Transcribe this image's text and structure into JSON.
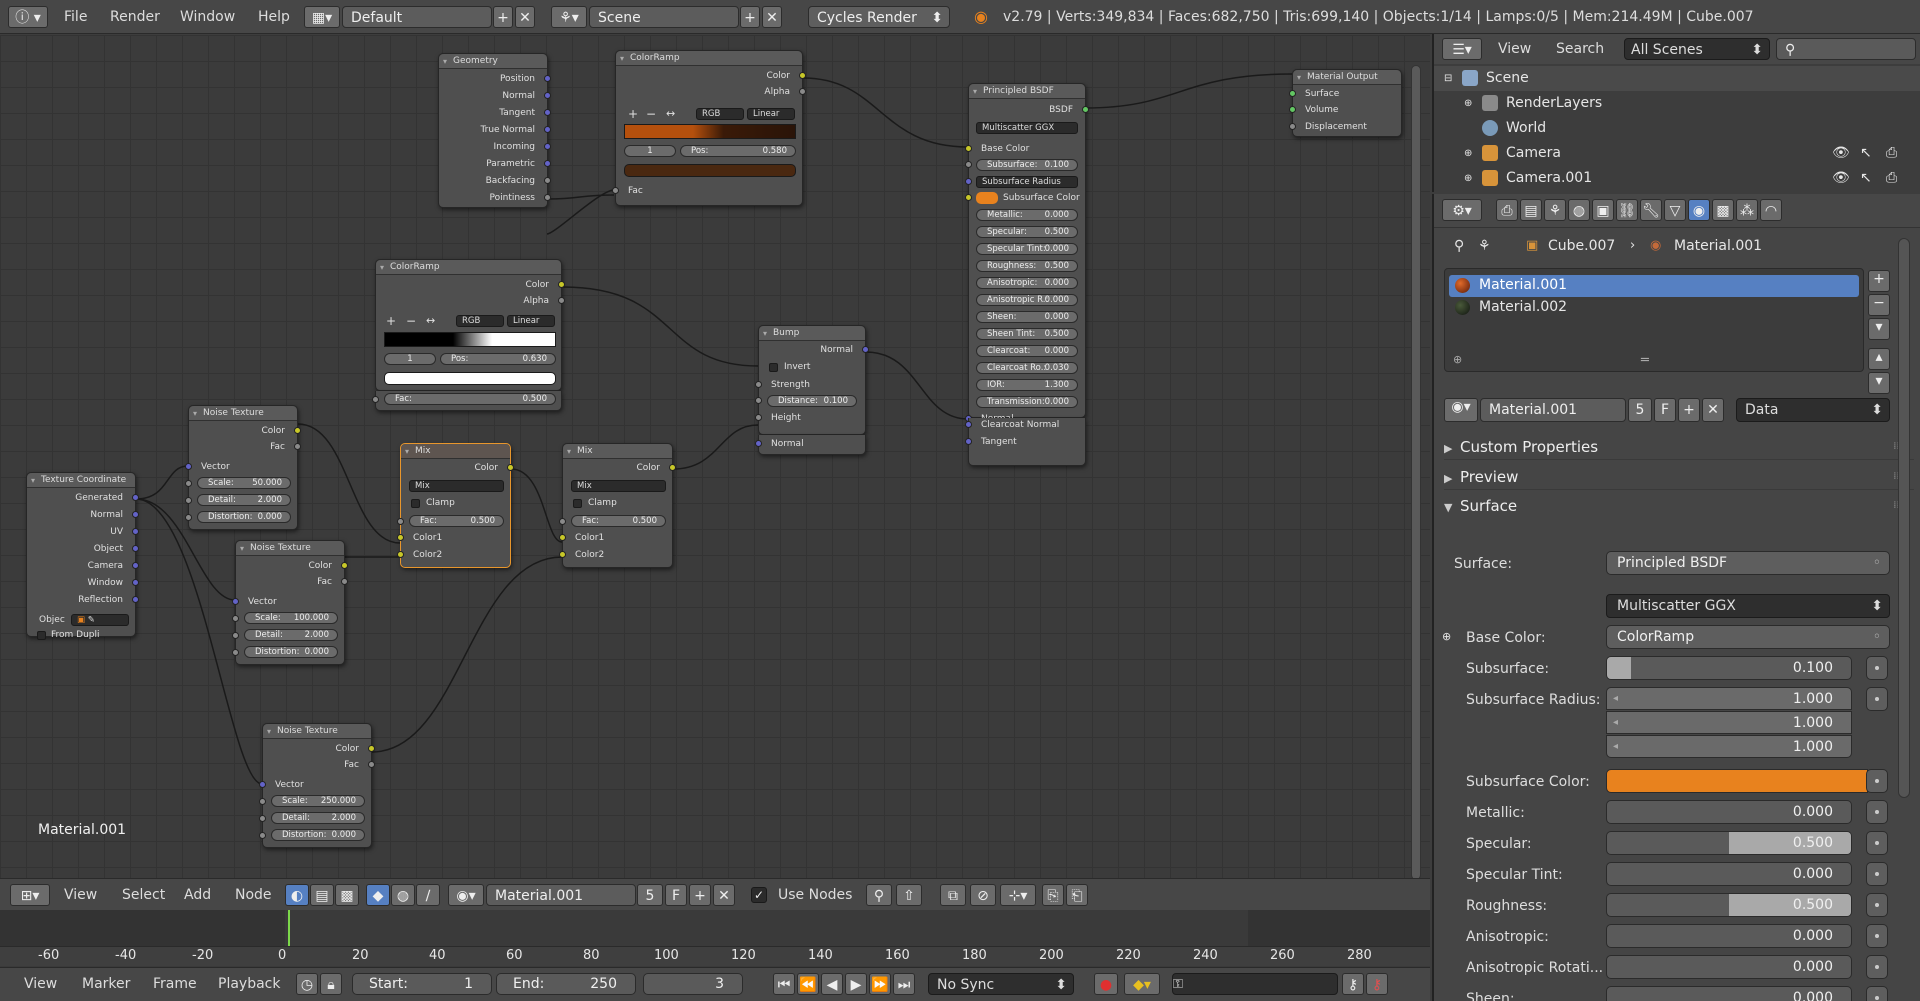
{
  "topbar": {
    "menus": [
      "File",
      "Render",
      "Window",
      "Help"
    ],
    "layout": "Default",
    "scene": "Scene",
    "engine": "Cycles Render",
    "stats": "v2.79 | Verts:349,834 | Faces:682,750 | Tris:699,140 | Objects:1/14 | Lamps:0/5 | Mem:214.49M | Cube.007"
  },
  "editor": {
    "material_label": "Material.001"
  },
  "nodes": {
    "geometry": {
      "title": "Geometry",
      "outputs": [
        "Position",
        "Normal",
        "Tangent",
        "True Normal",
        "Incoming",
        "Parametric",
        "Backfacing",
        "Pointiness"
      ]
    },
    "colorramp1": {
      "title": "ColorRamp",
      "out_color": "Color",
      "out_alpha": "Alpha",
      "mode": "RGB",
      "interp": "Linear",
      "index": "1",
      "pos_label": "Pos:",
      "pos_val": "0.580",
      "fac": "Fac"
    },
    "colorramp2": {
      "title": "ColorRamp",
      "out_color": "Color",
      "out_alpha": "Alpha",
      "mode": "RGB",
      "interp": "Linear",
      "index": "1",
      "pos_label": "Pos:",
      "pos_val": "0.630",
      "fac_label": "Fac:",
      "fac_val": "0.500"
    },
    "principled": {
      "title": "Principled BSDF",
      "out": "BSDF",
      "dist": "Multiscatter GGX",
      "base_color": "Base Color",
      "subsurface_label": "Subsurface:",
      "subsurface_val": "0.100",
      "ss_radius": "Subsurface Radius",
      "ss_color": "Subsurface Color",
      "params": [
        [
          "Metallic:",
          "0.000"
        ],
        [
          "Specular:",
          "0.500"
        ],
        [
          "Specular Tint:",
          "0.000"
        ],
        [
          "Roughness:",
          "0.500"
        ],
        [
          "Anisotropic:",
          "0.000"
        ],
        [
          "Anisotropic R.:",
          "0.000"
        ],
        [
          "Sheen:",
          "0.000"
        ],
        [
          "Sheen Tint:",
          "0.500"
        ],
        [
          "Clearcoat:",
          "0.000"
        ],
        [
          "Clearcoat Ro.:",
          "0.030"
        ],
        [
          "IOR:",
          "1.300"
        ],
        [
          "Transmission:",
          "0.000"
        ]
      ],
      "in_normal": "Normal",
      "in_cc_normal": "Clearcoat Normal",
      "in_tangent": "Tangent"
    },
    "output": {
      "title": "Material Output",
      "inputs": [
        "Surface",
        "Volume",
        "Displacement"
      ]
    },
    "bump": {
      "title": "Bump",
      "out": "Normal",
      "invert": "Invert",
      "strength": "Strength",
      "dist_label": "Distance:",
      "dist_val": "0.100",
      "height": "Height",
      "normal": "Normal"
    },
    "noise1": {
      "title": "Noise Texture",
      "out_color": "Color",
      "out_fac": "Fac",
      "vector": "Vector",
      "scale_l": "Scale:",
      "scale_v": "50.000",
      "detail_l": "Detail:",
      "detail_v": "2.000",
      "dist_l": "Distortion:",
      "dist_v": "0.000"
    },
    "noise2": {
      "title": "Noise Texture",
      "out_color": "Color",
      "out_fac": "Fac",
      "vector": "Vector",
      "scale_l": "Scale:",
      "scale_v": "100.000",
      "detail_l": "Detail:",
      "detail_v": "2.000",
      "dist_l": "Distortion:",
      "dist_v": "0.000"
    },
    "noise3": {
      "title": "Noise Texture",
      "out_color": "Color",
      "out_fac": "Fac",
      "vector": "Vector",
      "scale_l": "Scale:",
      "scale_v": "250.000",
      "detail_l": "Detail:",
      "detail_v": "2.000",
      "dist_l": "Distortion:",
      "dist_v": "0.000"
    },
    "texcoord": {
      "title": "Texture Coordinate",
      "outputs": [
        "Generated",
        "Normal",
        "UV",
        "Object",
        "Camera",
        "Window",
        "Reflection"
      ],
      "object": "Objec",
      "from_dupli": "From Dupli"
    },
    "mix1": {
      "title": "Mix",
      "out": "Color",
      "blend": "Mix",
      "clamp": "Clamp",
      "fac_l": "Fac:",
      "fac_v": "0.500",
      "c1": "Color1",
      "c2": "Color2"
    },
    "mix2": {
      "title": "Mix",
      "out": "Color",
      "blend": "Mix",
      "clamp": "Clamp",
      "fac_l": "Fac:",
      "fac_v": "0.500",
      "c1": "Color1",
      "c2": "Color2"
    }
  },
  "nodeheader": {
    "menus": [
      "View",
      "Select",
      "Add",
      "Node"
    ],
    "material": "Material.001",
    "users": "5",
    "fake": "F",
    "use_nodes": "Use Nodes"
  },
  "timeline": {
    "ticks": [
      "-60",
      "-40",
      "-20",
      "0",
      "20",
      "40",
      "60",
      "80",
      "100",
      "120",
      "140",
      "160",
      "180",
      "200",
      "220",
      "240",
      "260",
      "280"
    ],
    "menus": [
      "View",
      "Marker",
      "Frame",
      "Playback"
    ],
    "start_l": "Start:",
    "start_v": "1",
    "end_l": "End:",
    "end_v": "250",
    "current": "3",
    "sync": "No Sync"
  },
  "outliner": {
    "menus": [
      "View",
      "Search"
    ],
    "filter": "All Scenes",
    "items": [
      "Scene",
      "RenderLayers",
      "World",
      "Camera",
      "Camera.001"
    ]
  },
  "properties": {
    "crumb_obj": "Cube.007",
    "crumb_mat": "Material.001",
    "slots": [
      "Material.001",
      "Material.002"
    ],
    "mat_name": "Material.001",
    "users": "5",
    "fake": "F",
    "link": "Data",
    "sections": [
      "Custom Properties",
      "Preview",
      "Surface"
    ],
    "surface_label": "Surface:",
    "surface_val": "Principled BSDF",
    "distribution": "Multiscatter GGX",
    "base_color_l": "Base Color:",
    "base_color_v": "ColorRamp",
    "subsurface_l": "Subsurface:",
    "subsurface_v": "0.100",
    "ss_radius_l": "Subsurface Radius:",
    "ss_radius_v": [
      "1.000",
      "1.000",
      "1.000"
    ],
    "ss_color_l": "Subsurface Color:",
    "params": [
      [
        "Metallic:",
        "0.000"
      ],
      [
        "Specular:",
        "0.500"
      ],
      [
        "Specular Tint:",
        "0.000"
      ],
      [
        "Roughness:",
        "0.500"
      ],
      [
        "Anisotropic:",
        "0.000"
      ],
      [
        "Anisotropic Rotati...",
        "0.000"
      ],
      [
        "Sheen:",
        "0.000"
      ]
    ]
  },
  "colors": {
    "accent": "#e8962c",
    "orange": "#e8821e",
    "select": "#5680c2"
  }
}
